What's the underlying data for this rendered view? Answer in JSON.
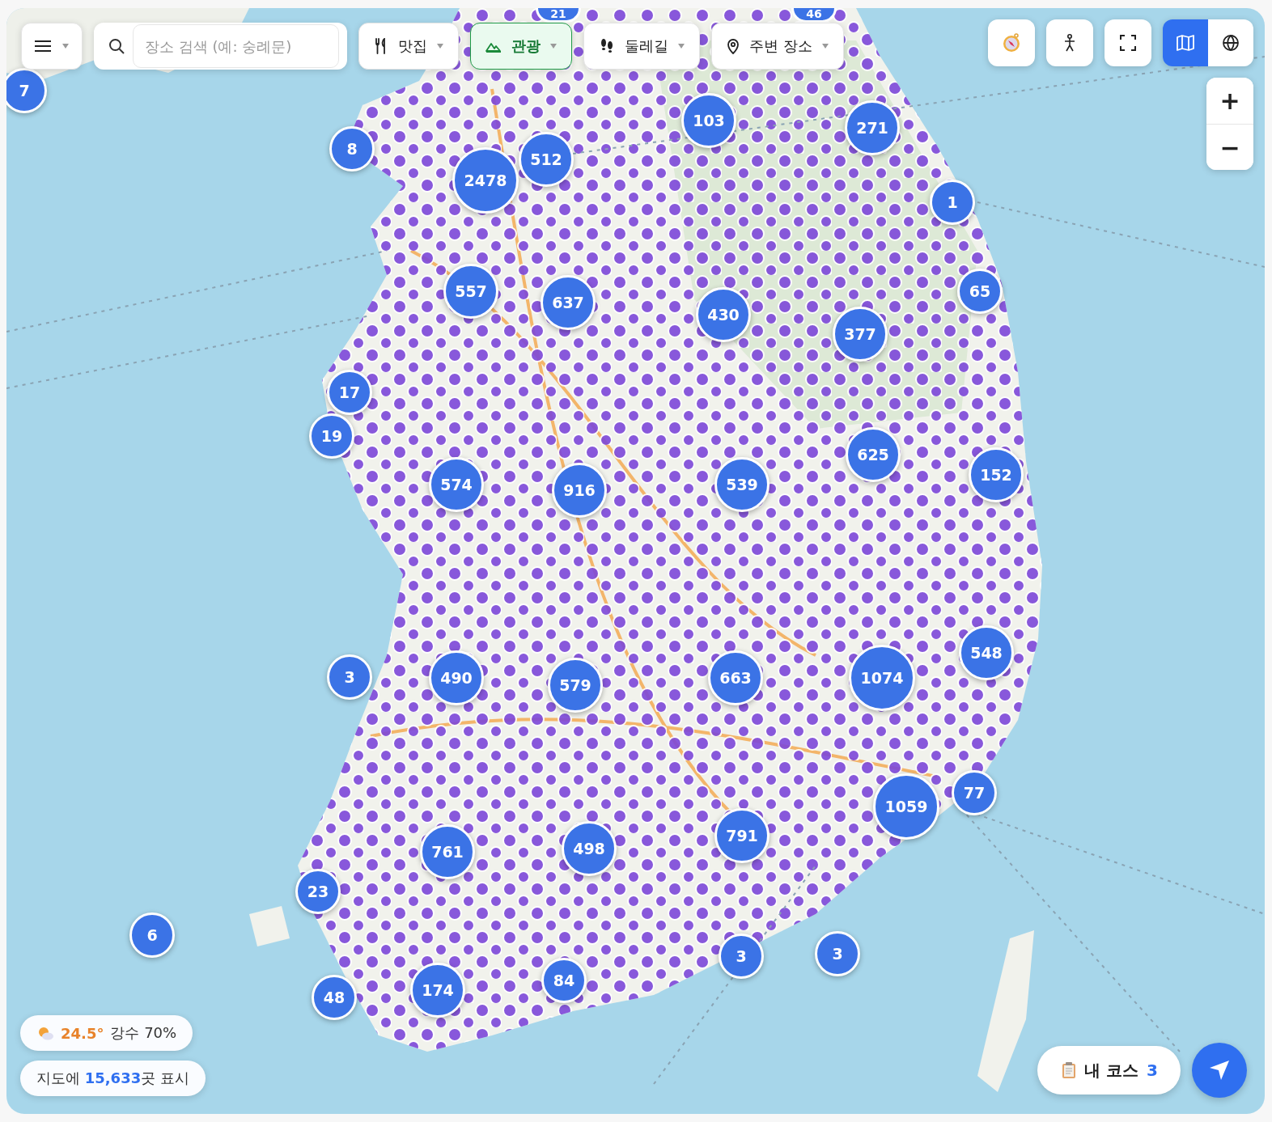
{
  "toolbar": {
    "search": {
      "placeholder": "장소 검색 (예: 숭례문)"
    },
    "categories": [
      {
        "kind": "food",
        "label": "맛집",
        "selected": false
      },
      {
        "kind": "tour",
        "label": "관광",
        "selected": true
      },
      {
        "kind": "trail",
        "label": "둘레길",
        "selected": false
      },
      {
        "kind": "nearby",
        "label": "주변 장소",
        "selected": false
      }
    ]
  },
  "map_controls": {
    "view_modes": [
      {
        "kind": "map",
        "selected": true
      },
      {
        "kind": "globe",
        "selected": false
      }
    ],
    "zoom_in": "+",
    "zoom_out": "−"
  },
  "clusters": [
    {
      "count": "21"
    },
    {
      "count": "46"
    },
    {
      "count": "7"
    },
    {
      "count": "8"
    },
    {
      "count": "2478"
    },
    {
      "count": "512"
    },
    {
      "count": "103"
    },
    {
      "count": "271"
    },
    {
      "count": "1"
    },
    {
      "count": "557"
    },
    {
      "count": "637"
    },
    {
      "count": "430"
    },
    {
      "count": "377"
    },
    {
      "count": "65"
    },
    {
      "count": "17"
    },
    {
      "count": "19"
    },
    {
      "count": "625"
    },
    {
      "count": "152"
    },
    {
      "count": "574"
    },
    {
      "count": "916"
    },
    {
      "count": "539"
    },
    {
      "count": "548"
    },
    {
      "count": "3"
    },
    {
      "count": "490"
    },
    {
      "count": "579"
    },
    {
      "count": "663"
    },
    {
      "count": "1074"
    },
    {
      "count": "77"
    },
    {
      "count": "1059"
    },
    {
      "count": "761"
    },
    {
      "count": "498"
    },
    {
      "count": "791"
    },
    {
      "count": "23"
    },
    {
      "count": "6"
    },
    {
      "count": "3"
    },
    {
      "count": "3"
    },
    {
      "count": "48"
    },
    {
      "count": "174"
    },
    {
      "count": "84"
    }
  ],
  "weather": {
    "temperature": "24.5°",
    "precipitation": "강수 70%"
  },
  "place_count": {
    "prefix": "지도에 ",
    "count": "15,633",
    "suffix": "곳 표시"
  },
  "my_course": {
    "label": "내 코스",
    "count": "3"
  }
}
